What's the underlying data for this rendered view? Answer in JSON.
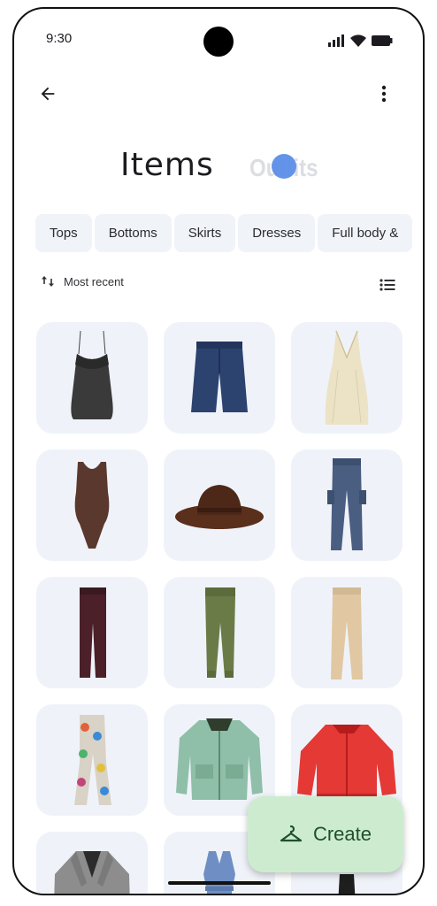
{
  "status_bar": {
    "time": "9:30"
  },
  "header": {
    "tab_items": "Items",
    "tab_outfits": "Outfits"
  },
  "filters": [
    "Tops",
    "Bottoms",
    "Skirts",
    "Dresses",
    "Full body &"
  ],
  "sort": {
    "label": "Most recent"
  },
  "items": [
    {
      "name": "black camisole"
    },
    {
      "name": "denim shorts"
    },
    {
      "name": "cream gown"
    },
    {
      "name": "brown bodysuit"
    },
    {
      "name": "brown hat"
    },
    {
      "name": "blue pants"
    },
    {
      "name": "maroon pants"
    },
    {
      "name": "olive joggers"
    },
    {
      "name": "beige trousers"
    },
    {
      "name": "printed flares"
    },
    {
      "name": "green jacket"
    },
    {
      "name": "red bomber"
    },
    {
      "name": "grey blazer"
    },
    {
      "name": "blue jumpsuit"
    },
    {
      "name": "black dress"
    }
  ],
  "fab": {
    "label": "Create"
  },
  "colors": {
    "accent": "#1f4f2c",
    "fab_bg": "#cdeccf",
    "chip_bg": "#f0f3f8",
    "tile_bg": "#eff3f9"
  }
}
